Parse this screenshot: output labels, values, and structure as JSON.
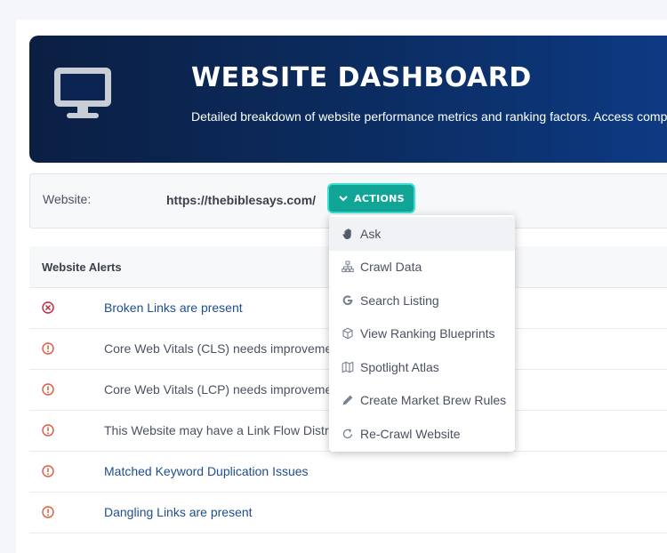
{
  "header": {
    "title": "WEBSITE DASHBOARD",
    "subtitle": "Detailed breakdown of website performance metrics and ranking factors. Access comp",
    "icon": "monitor-icon"
  },
  "website": {
    "label": "Website:",
    "url": "https://thebiblesays.com/"
  },
  "actions": {
    "label": "ACTIONS",
    "icon": "chevron-down-icon",
    "items": [
      {
        "label": "Ask",
        "icon": "hand-icon",
        "active": true
      },
      {
        "label": "Crawl Data",
        "icon": "sitemap-icon"
      },
      {
        "label": "Search Listing",
        "icon": "google-icon"
      },
      {
        "label": "View Ranking Blueprints",
        "icon": "cube-icon"
      },
      {
        "label": "Spotlight Atlas",
        "icon": "map-icon"
      },
      {
        "label": "Create Market Brew Rules",
        "icon": "pencil-icon"
      },
      {
        "label": "Re-Crawl Website",
        "icon": "redo-icon"
      }
    ]
  },
  "alerts": {
    "title": "Website Alerts",
    "rows": [
      {
        "text": "Broken Links are present",
        "status": "error",
        "link": true
      },
      {
        "text": "Core Web Vitals (CLS) needs improvement",
        "status": "warning",
        "link": false
      },
      {
        "text": "Core Web Vitals (LCP) needs improvement",
        "status": "warning",
        "link": false
      },
      {
        "text": "This Website may have a Link Flow Distribution issue",
        "status": "warning",
        "link": false
      },
      {
        "text": "Matched Keyword Duplication Issues",
        "status": "warning",
        "link": true
      },
      {
        "text": "Dangling Links are present",
        "status": "warning",
        "link": true
      }
    ]
  },
  "colors": {
    "accent": "#10a596",
    "error": "#c0243b",
    "warning": "#e0573a",
    "link": "#1f4e8c"
  }
}
